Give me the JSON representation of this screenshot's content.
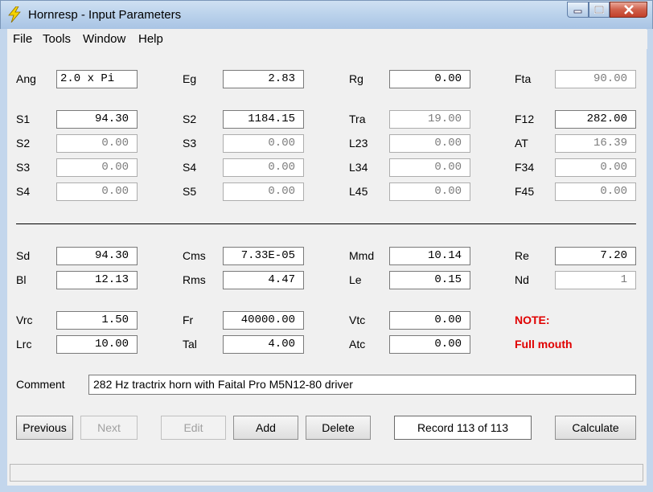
{
  "window": {
    "title": "Hornresp - Input Parameters",
    "icon": "lightning-icon"
  },
  "menu": [
    "File",
    "Tools",
    "Window",
    "Help"
  ],
  "fields": {
    "ang": {
      "label": "Ang",
      "value": "2.0 x Pi"
    },
    "eg": {
      "label": "Eg",
      "value": "2.83"
    },
    "rg": {
      "label": "Rg",
      "value": "0.00"
    },
    "fta": {
      "label": "Fta",
      "value": "90.00"
    },
    "s1": {
      "label": "S1",
      "value": "94.30"
    },
    "s2_top": {
      "label": "S2",
      "value": "1184.15"
    },
    "tra": {
      "label": "Tra",
      "value": "19.00"
    },
    "f12": {
      "label": "F12",
      "value": "282.00"
    },
    "s2": {
      "label": "S2",
      "value": "0.00"
    },
    "s3_mid": {
      "label": "S3",
      "value": "0.00"
    },
    "l23": {
      "label": "L23",
      "value": "0.00"
    },
    "at": {
      "label": "AT",
      "value": "16.39"
    },
    "s3": {
      "label": "S3",
      "value": "0.00"
    },
    "s4_mid": {
      "label": "S4",
      "value": "0.00"
    },
    "l34": {
      "label": "L34",
      "value": "0.00"
    },
    "f34": {
      "label": "F34",
      "value": "0.00"
    },
    "s4": {
      "label": "S4",
      "value": "0.00"
    },
    "s5": {
      "label": "S5",
      "value": "0.00"
    },
    "l45": {
      "label": "L45",
      "value": "0.00"
    },
    "f45": {
      "label": "F45",
      "value": "0.00"
    },
    "sd": {
      "label": "Sd",
      "value": "94.30"
    },
    "cms": {
      "label": "Cms",
      "value": "7.33E-05"
    },
    "mmd": {
      "label": "Mmd",
      "value": "10.14"
    },
    "re": {
      "label": "Re",
      "value": "7.20"
    },
    "bl": {
      "label": "Bl",
      "value": "12.13"
    },
    "rms": {
      "label": "Rms",
      "value": "4.47"
    },
    "le": {
      "label": "Le",
      "value": "0.15"
    },
    "nd": {
      "label": "Nd",
      "value": "1"
    },
    "vrc": {
      "label": "Vrc",
      "value": "1.50"
    },
    "fr": {
      "label": "Fr",
      "value": "40000.00"
    },
    "vtc": {
      "label": "Vtc",
      "value": "0.00"
    },
    "lrc": {
      "label": "Lrc",
      "value": "10.00"
    },
    "tal": {
      "label": "Tal",
      "value": "4.00"
    },
    "atc": {
      "label": "Atc",
      "value": "0.00"
    }
  },
  "note": {
    "title": "NOTE:",
    "text": "Full mouth",
    "color": "#e00000"
  },
  "comment": {
    "label": "Comment",
    "value": "282 Hz tractrix horn with Faital Pro M5N12-80 driver"
  },
  "buttons": {
    "previous": "Previous",
    "next": "Next",
    "edit": "Edit",
    "add": "Add",
    "delete": "Delete",
    "calculate": "Calculate"
  },
  "record": "Record 113 of 113"
}
